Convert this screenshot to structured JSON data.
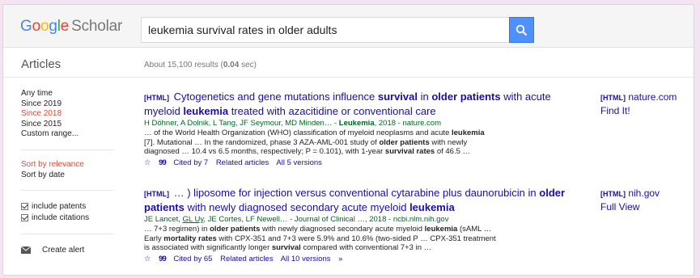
{
  "header": {
    "logo": {
      "g1": "G",
      "g2": "o",
      "g3": "o",
      "g4": "g",
      "g5": "l",
      "g6": "e",
      "scholar": "Scholar"
    },
    "search": {
      "value": "leukemia survival rates in older adults"
    }
  },
  "subheader": {
    "articles_label": "Articles",
    "results_prefix": "About 15,100 results (",
    "results_time": "0.04",
    "results_suffix": " sec)"
  },
  "sidebar": {
    "time_filters": [
      "Any time",
      "Since 2019",
      "Since 2018",
      "Since 2015",
      "Custom range..."
    ],
    "sort_relevance": "Sort by relevance",
    "sort_date": "Sort by date",
    "include_patents": "include patents",
    "include_citations": "include citations",
    "create_alert": "Create alert"
  },
  "results": [
    {
      "tag": "[HTML]",
      "title_parts": [
        "Cytogenetics and gene mutations influence ",
        "survival",
        " in ",
        "older patients",
        " with acute myeloid ",
        "leukemia",
        " treated with azacitidine or conventional care"
      ],
      "authors": "H Döhner, A Dolnik, L Tang, JF Seymour, MD Minden… - ",
      "journal_bold": "Leukemia",
      "journal_rest": ", 2018 - nature.com",
      "snippet_line1": "… of the World Health Organization (WHO) classification of myeloid neoplasms and acute ",
      "snippet_line1_b": "leukemia",
      "snippet_line2a": "[7]. Mutational … In the randomized, phase 3 AZA-AML-001 study of ",
      "snippet_line2_b": "older patients",
      "snippet_line2c": " with newly",
      "snippet_line3a": "diagnosed … 10.4 vs 6.5 months, respectively; P = 0.101), with 1-year ",
      "snippet_line3_b": "survival rates",
      "snippet_line3c": " of 46.5 …",
      "star": "☆",
      "quote": "99",
      "cited_by": "Cited by 7",
      "related": "Related articles",
      "versions": "All 5 versions",
      "side_tag": "[HTML]",
      "side_source": "nature.com",
      "side_link": "Find It!"
    },
    {
      "tag": "[HTML]",
      "title_parts": [
        "… ) liposome for injection versus conventional cytarabine plus daunorubicin in ",
        "older patients",
        " with newly diagnosed secondary acute myeloid ",
        "leukemia"
      ],
      "authors_a": "JE Lancet, ",
      "authors_u": "GL Uy",
      "authors_b": ", JE Cortes, LF Newell… - Journal of Clinical …, 2018 - ncbi.nlm.nih.gov",
      "snippet_line1a": "… 7+3 regimen) in ",
      "snippet_line1_b": "older patients",
      "snippet_line1c": " with newly diagnosed secondary acute myeloid ",
      "snippet_line1_b2": "leukemia",
      "snippet_line1d": " (sAML …",
      "snippet_line2a": "Early ",
      "snippet_line2_b": "mortality rates",
      "snippet_line2c": " with CPX-351 and 7+3 were 5.9% and 10.6% (two-sided P … CPX-351 treatment",
      "snippet_line3a": "is associated with significantly longer ",
      "snippet_line3_b": "survival",
      "snippet_line3c": " compared with conventional 7+3 in …",
      "star": "☆",
      "quote": "99",
      "cited_by": "Cited by 65",
      "related": "Related articles",
      "versions": "All 10 versions",
      "more": "»",
      "side_tag": "[HTML]",
      "side_source": "nih.gov",
      "side_link": "Full View"
    }
  ]
}
